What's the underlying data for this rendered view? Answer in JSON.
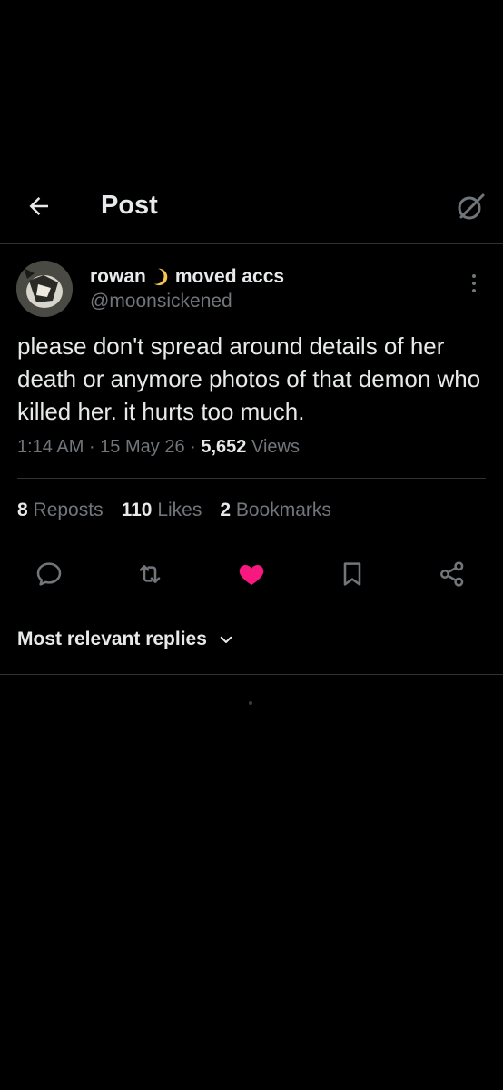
{
  "header": {
    "title": "Post",
    "back_icon": "arrow-left-icon",
    "grok_icon": "grok-icon"
  },
  "post": {
    "author_name": "rowan",
    "name_emoji_icon": "crescent-moon-icon",
    "author_name_suffix": "moved accs",
    "handle": "@moonsickened",
    "text": "please don't spread around details of her death or anymore photos of that demon who killed her. it hurts too much.",
    "time": "1:14 AM",
    "date": "15 May 26",
    "views_count": "5,652",
    "views_label": "Views"
  },
  "stats": {
    "reposts_count": "8",
    "reposts_label": "Reposts",
    "likes_count": "110",
    "likes_label": "Likes",
    "bookmarks_count": "2",
    "bookmarks_label": "Bookmarks"
  },
  "replies": {
    "sort_label": "Most relevant replies"
  },
  "colors": {
    "background": "#000000",
    "text": "#e7e9ea",
    "secondary": "#71767b",
    "divider": "#2f3336",
    "like": "#f91880"
  }
}
